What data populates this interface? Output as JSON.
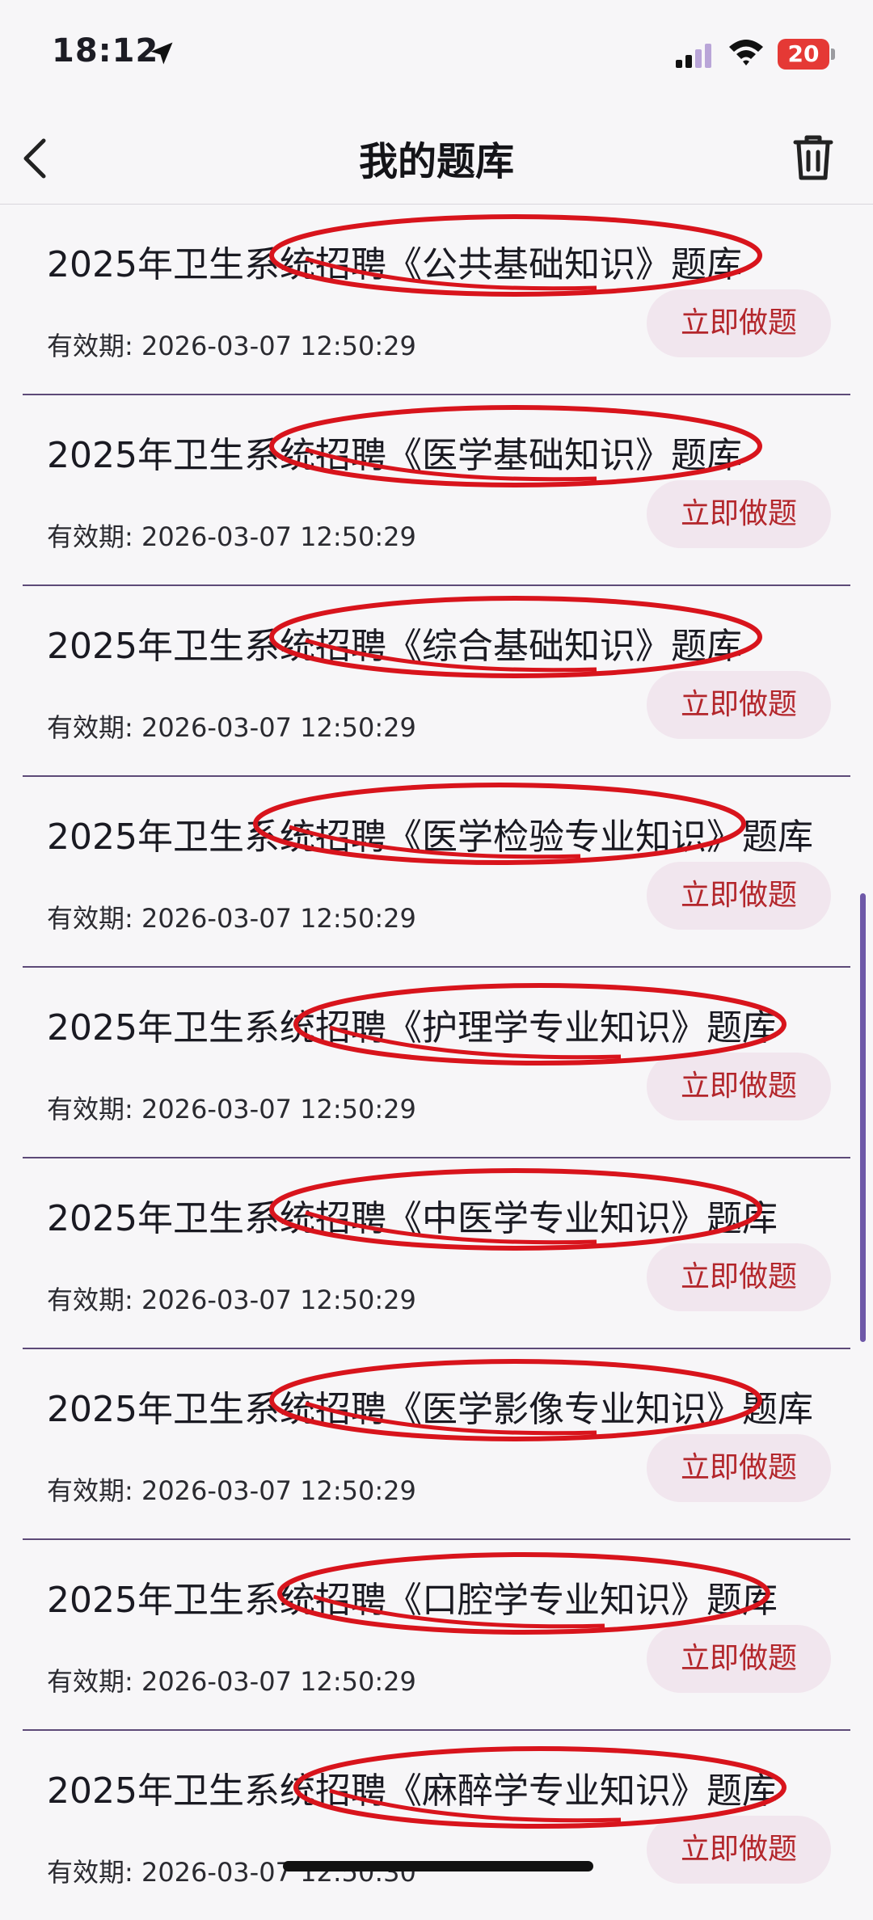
{
  "status_bar": {
    "time": "18:12",
    "battery": "20"
  },
  "nav": {
    "title": "我的题库"
  },
  "items": [
    {
      "title": "2025年卫生系统招聘《公共基础知识》题库",
      "expiry": "有效期: 2026-03-07 12:50:29",
      "button": "立即做题"
    },
    {
      "title": "2025年卫生系统招聘《医学基础知识》题库",
      "expiry": "有效期: 2026-03-07 12:50:29",
      "button": "立即做题"
    },
    {
      "title": "2025年卫生系统招聘《综合基础知识》题库",
      "expiry": "有效期: 2026-03-07 12:50:29",
      "button": "立即做题"
    },
    {
      "title": "2025年卫生系统招聘《医学检验专业知识》题库",
      "expiry": "有效期: 2026-03-07 12:50:29",
      "button": "立即做题"
    },
    {
      "title": "2025年卫生系统招聘《护理学专业知识》题库",
      "expiry": "有效期: 2026-03-07 12:50:29",
      "button": "立即做题"
    },
    {
      "title": "2025年卫生系统招聘《中医学专业知识》题库",
      "expiry": "有效期: 2026-03-07 12:50:29",
      "button": "立即做题"
    },
    {
      "title": "2025年卫生系统招聘《医学影像专业知识》题库",
      "expiry": "有效期: 2026-03-07 12:50:29",
      "button": "立即做题"
    },
    {
      "title": "2025年卫生系统招聘《口腔学专业知识》题库",
      "expiry": "有效期: 2026-03-07 12:50:29",
      "button": "立即做题"
    },
    {
      "title": "2025年卫生系统招聘《麻醉学专业知识》题库",
      "expiry": "有效期: 2026-03-07 12:50:30",
      "button": "立即做题"
    }
  ],
  "colors": {
    "accent_text": "#b3262b",
    "button_bg": "#f1e6ee",
    "highlight_circle": "#d8141c",
    "divider": "#5d4a78"
  },
  "icons": {
    "back": "chevron-left-icon",
    "trash": "trash-icon",
    "location": "location-arrow-icon",
    "signal": "cellular-signal-icon",
    "wifi": "wifi-icon"
  }
}
